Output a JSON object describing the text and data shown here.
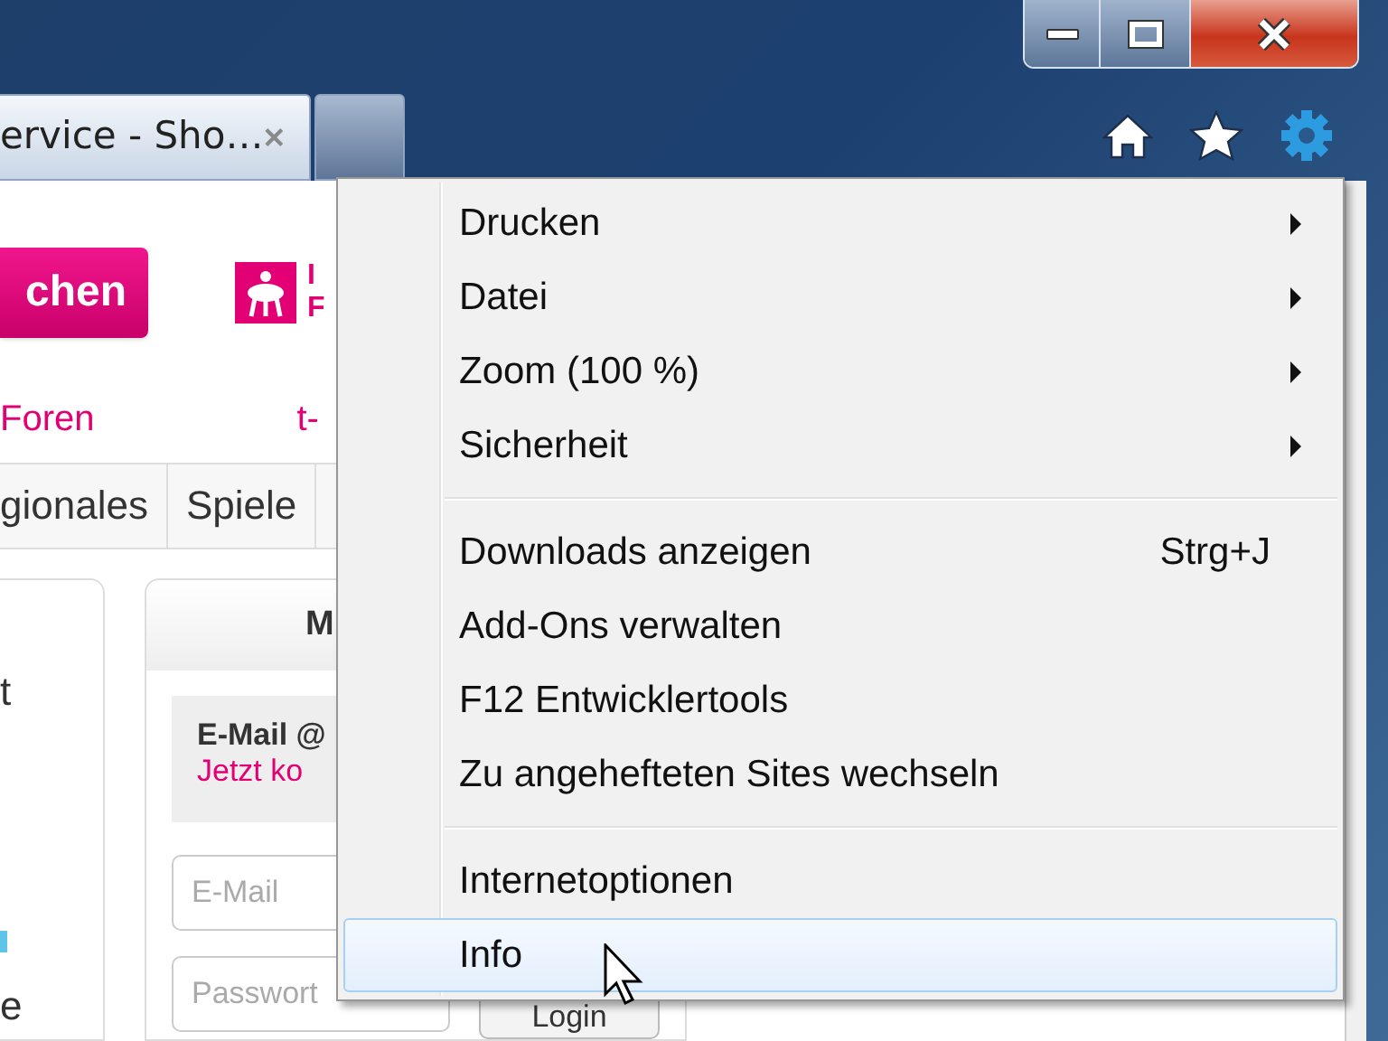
{
  "tabs": [
    {
      "label": "ervice - Sho…",
      "selected": true
    }
  ],
  "page": {
    "search_button": "chen",
    "promo": [
      "I",
      "F"
    ],
    "links": [
      "Foren",
      "t-"
    ],
    "nav": [
      {
        "label": "gionales"
      },
      {
        "label": "Spiele"
      }
    ],
    "sidebar_fragments": [
      "t",
      "e"
    ],
    "login_card": {
      "title": "M",
      "heading": "E-Mail @",
      "link": "Jetzt ko",
      "email_placeholder": "E-Mail",
      "password_placeholder": "Passwort",
      "button": "Login"
    }
  },
  "menu": [
    {
      "kind": "item",
      "label": "Drucken",
      "submenu": true,
      "selected": false
    },
    {
      "kind": "item",
      "label": "Datei",
      "submenu": true,
      "selected": false
    },
    {
      "kind": "item",
      "label": "Zoom (100 %)",
      "submenu": true,
      "selected": false
    },
    {
      "kind": "item",
      "label": "Sicherheit",
      "submenu": true,
      "selected": false
    },
    {
      "kind": "separator"
    },
    {
      "kind": "item",
      "label": "Downloads anzeigen",
      "submenu": false,
      "shortcut": "Strg+J",
      "selected": false
    },
    {
      "kind": "item",
      "label": "Add-Ons verwalten",
      "submenu": false,
      "selected": false
    },
    {
      "kind": "item",
      "label": "F12 Entwicklertools",
      "submenu": false,
      "selected": false
    },
    {
      "kind": "item",
      "label": "Zu angehefteten Sites wechseln",
      "submenu": false,
      "selected": false
    },
    {
      "kind": "separator"
    },
    {
      "kind": "item",
      "label": "Internetoptionen",
      "submenu": false,
      "selected": false
    },
    {
      "kind": "item",
      "label": "Info",
      "submenu": false,
      "selected": true
    }
  ]
}
